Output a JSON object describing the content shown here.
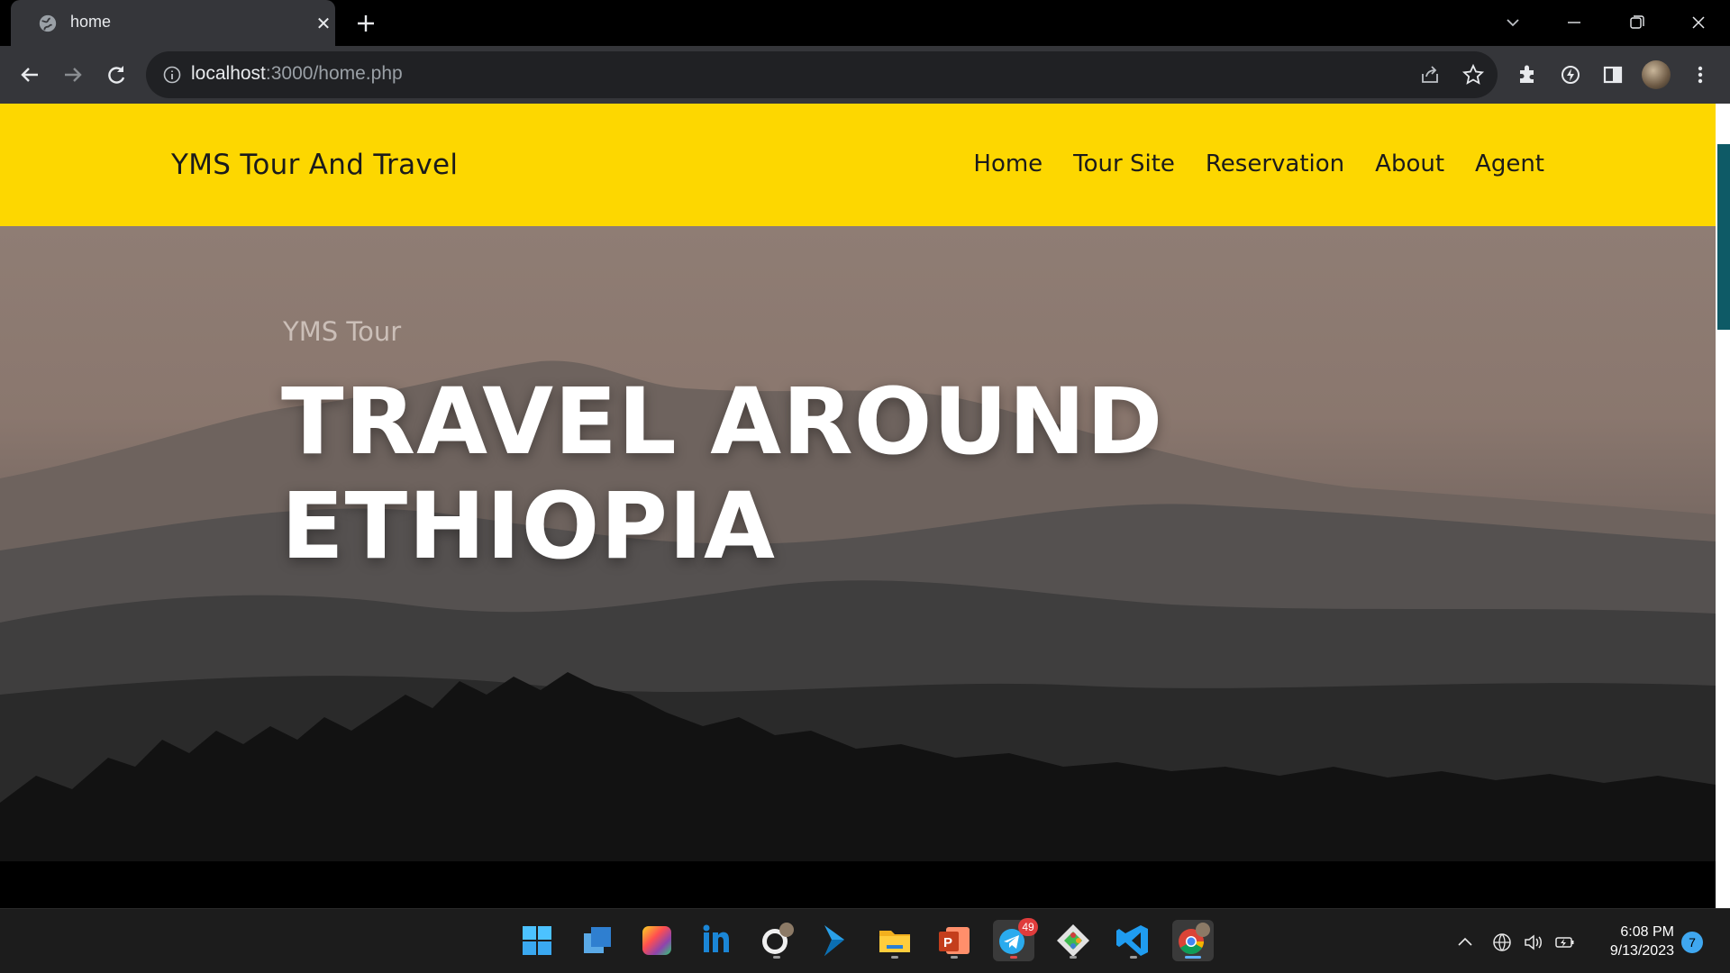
{
  "browser": {
    "tab_title": "home",
    "url_host": "localhost",
    "url_path": ":3000/home.php"
  },
  "site": {
    "brand": "YMS Tour And Travel",
    "menu": [
      "Home",
      "Tour Site",
      "Reservation",
      "About",
      "Agent"
    ],
    "accent_color": "#fdd700"
  },
  "hero": {
    "subtitle": "YMS Tour",
    "title_line1": "TRAVEL AROUND",
    "title_line2": "ETHIOPIA"
  },
  "taskbar": {
    "apps": [
      "start-icon",
      "app-window-icon",
      "photos-icon",
      "linkedin-icon",
      "github-icon",
      "app-arrow-icon",
      "file-explorer-icon",
      "powerpoint-icon",
      "telegram-icon",
      "git-icon",
      "vscode-icon",
      "chrome-icon"
    ],
    "telegram_badge": "49",
    "time": "6:08 PM",
    "date": "9/13/2023",
    "notification_count": "7"
  }
}
